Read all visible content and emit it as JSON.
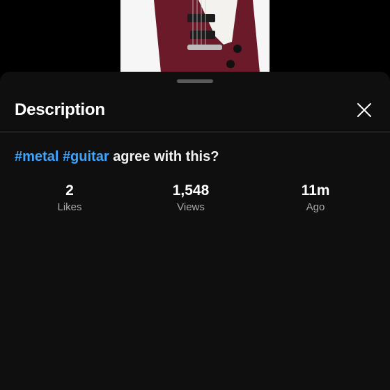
{
  "description_panel": {
    "title": "Description",
    "close_icon": "close-icon",
    "text_hashtags": [
      "#metal",
      "#guitar"
    ],
    "text_body": "agree with this?",
    "stats": [
      {
        "value": "2",
        "label": "Likes"
      },
      {
        "value": "1,548",
        "label": "Views"
      },
      {
        "value": "11m",
        "label": "Ago"
      }
    ]
  },
  "colors": {
    "background": "#000000",
    "sheet": "#0f0f0f",
    "hashtag": "#3ea6ff",
    "guitar_body": "#6b1a2a"
  }
}
